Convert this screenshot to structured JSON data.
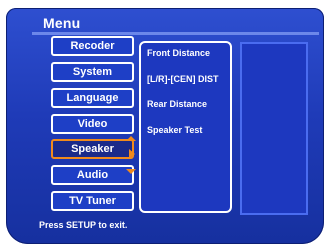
{
  "menu": {
    "title": "Menu",
    "items": [
      {
        "label": "Recoder"
      },
      {
        "label": "System"
      },
      {
        "label": "Language"
      },
      {
        "label": "Video"
      },
      {
        "label": "Speaker"
      },
      {
        "label": "Audio"
      },
      {
        "label": "TV Tuner"
      }
    ],
    "selected": "Speaker"
  },
  "submenu": {
    "items": [
      {
        "label": "Front Distance"
      },
      {
        "label": "[L/R]-[CEN] DIST"
      },
      {
        "label": "Rear Distance"
      },
      {
        "label": "Speaker Test"
      }
    ]
  },
  "footer": {
    "hint": "Press SETUP to exit."
  },
  "colors": {
    "panel": "#1f3bb8",
    "selected_border": "#f08a1c",
    "text": "#ffffff"
  },
  "icons": {
    "up": "arrow-up-icon",
    "down": "arrow-down-icon",
    "right": "arrow-right-icon"
  }
}
